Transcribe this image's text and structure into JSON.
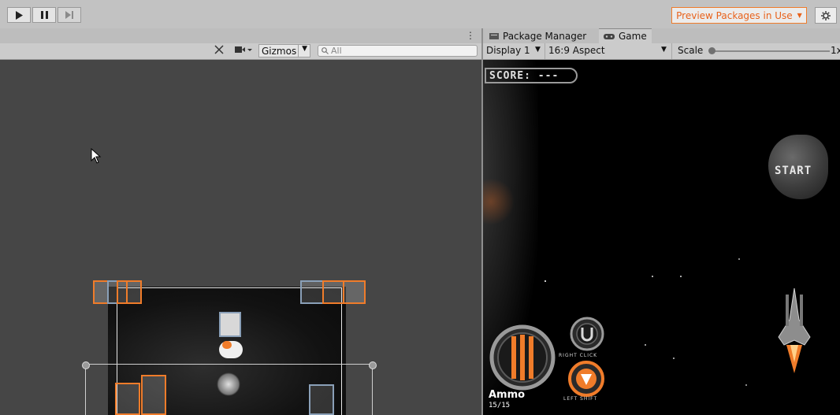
{
  "toolbar": {
    "play_icon": "play-icon",
    "pause_icon": "pause-icon",
    "step_icon": "step-icon",
    "preview_packages_label": "Preview Packages in Use",
    "settings_icon": "gear-icon"
  },
  "scene": {
    "menu_icon": "more-icon",
    "gizmos_label": "Gizmos",
    "search_placeholder": "All"
  },
  "game": {
    "tabs": [
      {
        "label": "Package Manager",
        "icon": "package-icon"
      },
      {
        "label": "Game",
        "icon": "gamepad-icon"
      }
    ],
    "display_label": "Display 1",
    "aspect_label": "16:9 Aspect",
    "scale_label": "Scale",
    "scale_value": "1x",
    "hud": {
      "score_text": "SCORE: ---",
      "start_text": "START",
      "ammo_label": "Ammo",
      "ammo_count": "15/15",
      "right_click_label": "RIGHT CLICK",
      "left_shift_label": "LEFT SHIFT"
    }
  },
  "colors": {
    "accent_orange": "#f07c2a",
    "scene_bg": "#464646",
    "game_bg": "#000000"
  }
}
